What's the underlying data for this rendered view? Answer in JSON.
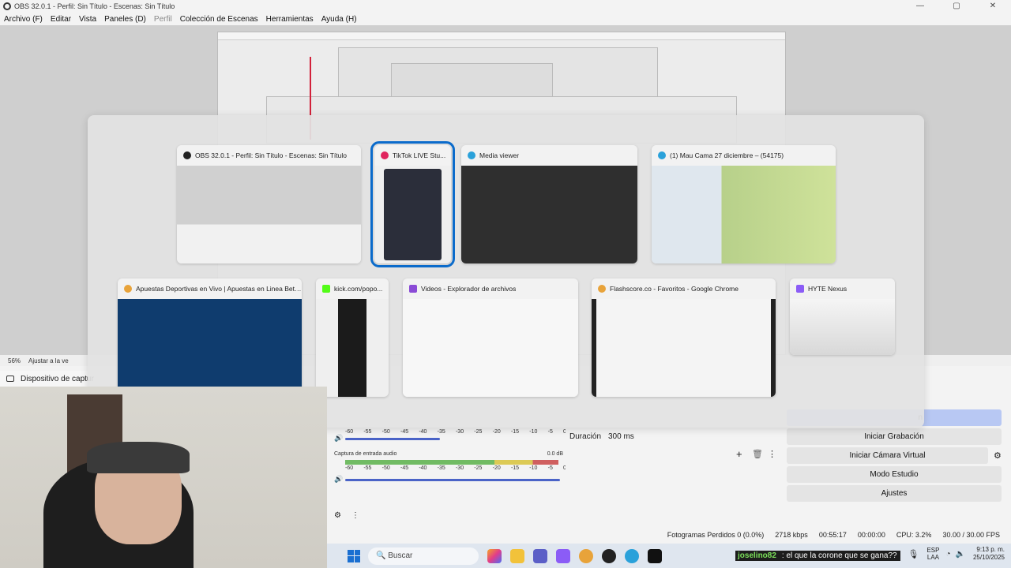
{
  "window": {
    "title": "OBS 32.0.1 - Perfil: Sin Título - Escenas: Sin Título",
    "controls": [
      "—",
      "▢",
      "✕"
    ]
  },
  "menu": [
    "Archivo (F)",
    "Editar",
    "Vista",
    "Paneles (D)",
    "Perfil",
    "Colección de Escenas",
    "Herramientas",
    "Ayuda (H)"
  ],
  "preview": {
    "zoom": "56%",
    "zoom_control": "Ajustar a la ve",
    "source_label": "Dispositivo de captur"
  },
  "switcher": {
    "row1": [
      {
        "title": "OBS 32.0.1 - Perfil: Sin Título - Escenas: Sin Título",
        "icon": "obs-icon",
        "icon_color": "#222222",
        "selected": false
      },
      {
        "title": "TikTok LIVE Stu...",
        "icon": "tiktok-icon",
        "icon_color": "#e0245e",
        "selected": true
      },
      {
        "title": "Media viewer",
        "icon": "telegram-icon",
        "icon_color": "#2aa1da",
        "selected": false
      },
      {
        "title": "(1) Mau Cama 27 diciembre – (54175)",
        "icon": "telegram-icon",
        "icon_color": "#2aa1da",
        "selected": false
      }
    ],
    "row2": [
      {
        "title": "Apuestas Deportivas en Vivo | Apuestas en Linea BetPl...",
        "icon": "chrome-icon",
        "icon_color": "#e8a33a",
        "selected": false
      },
      {
        "title": "kick.com/popo...",
        "icon": "kick-icon",
        "icon_color": "#53fc18",
        "selected": false
      },
      {
        "title": "Videos - Explorador de archivos",
        "icon": "video-folder-icon",
        "icon_color": "#8a4bd6",
        "selected": false
      },
      {
        "title": "Flashscore.co - Favoritos - Google Chrome",
        "icon": "chrome-icon",
        "icon_color": "#e8a33a",
        "selected": false
      },
      {
        "title": "HYTE Nexus",
        "icon": "hyte-icon",
        "icon_color": "#8b5cf6",
        "selected": false
      }
    ]
  },
  "audio": {
    "ticks": [
      "-60",
      "-55",
      "-50",
      "-45",
      "-40",
      "-35",
      "-30",
      "-25",
      "-20",
      "-15",
      "-10",
      "-5",
      "0"
    ],
    "channel_label": "Captura de entrada audio",
    "channel_db": "0.0 dB"
  },
  "transition": {
    "duration_label": "Duración",
    "duration_value": "300 ms"
  },
  "controls": {
    "start_recording": "Iniciar Grabación",
    "virtual_camera": "Iniciar Cámara Virtual",
    "studio_mode": "Modo Estudio",
    "settings": "Ajustes",
    "partial_active": "n"
  },
  "status": {
    "dropped": "Fotogramas Perdidos 0 (0.0%)",
    "bitrate": "2718 kbps",
    "live_time": "00:55:17",
    "rec_time": "00:00:00",
    "cpu": "CPU: 3.2%",
    "fps": "30.00 / 30.00 FPS"
  },
  "taskbar": {
    "search_placeholder": "Buscar",
    "chat_user": "joselino82",
    "chat_message": ": el que la corone que se gana??",
    "lang_top": "ESP",
    "lang_bottom": "LAA",
    "time": "9:13 p. m.",
    "date": "25/10/2025"
  }
}
